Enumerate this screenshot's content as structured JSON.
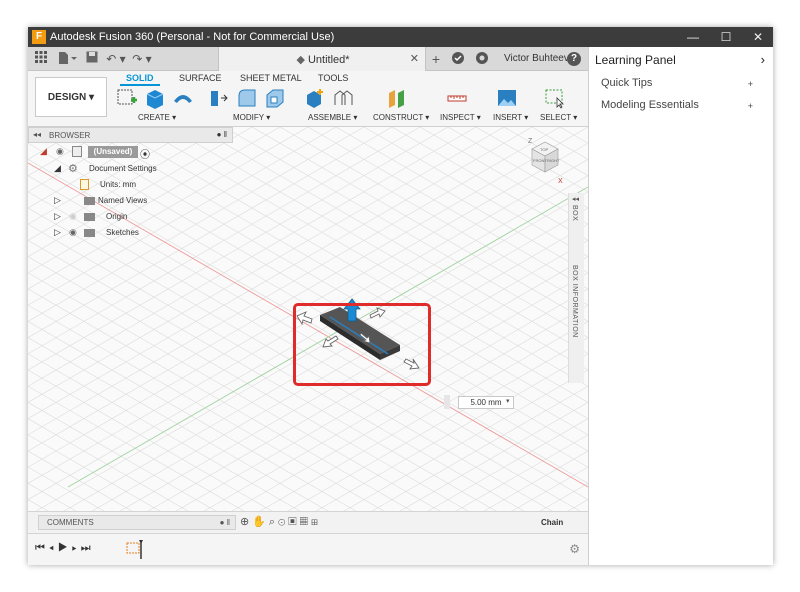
{
  "window": {
    "title": "Autodesk Fusion 360 (Personal - Not for Commercial Use)",
    "app_icon_letter": "F",
    "controls": {
      "minimize": "—",
      "maximize": "☐",
      "close": "✕"
    }
  },
  "topbar": {
    "document_tab": "Untitled*",
    "close_tab": "✕",
    "user": "Victor Buhteev",
    "help": "?"
  },
  "ribbon": {
    "design_button": "DESIGN ▾",
    "tabs": [
      "SOLID",
      "SURFACE",
      "SHEET METAL",
      "TOOLS"
    ],
    "active_tab": "SOLID",
    "groups": [
      "CREATE ▾",
      "MODIFY ▾",
      "ASSEMBLE ▾",
      "CONSTRUCT ▾",
      "INSPECT ▾",
      "INSERT ▾",
      "SELECT ▾"
    ]
  },
  "browser": {
    "title": "BROWSER",
    "root": "(Unsaved)",
    "items": [
      "Document Settings",
      "Units: mm",
      "Named Views",
      "Origin",
      "Sketches"
    ]
  },
  "side_panels": {
    "box": "BOX",
    "box_information": "BOX INFORMATION"
  },
  "viewcube": {
    "top": "TOP",
    "front": "FRONT",
    "right": "RIGHT",
    "z": "Z",
    "x": "X"
  },
  "dimension": {
    "value": "5.00 mm"
  },
  "bottom": {
    "comments": "COMMENTS",
    "chain": "Chain"
  },
  "learning_panel": {
    "title": "Learning Panel",
    "items": [
      {
        "label": "Quick Tips",
        "expand": "+"
      },
      {
        "label": "Modeling Essentials",
        "expand": "+"
      }
    ]
  },
  "colors": {
    "accent": "#0696d7",
    "highlight": "#e02b2b",
    "titlebar": "#3c3c3c",
    "x_axis": "#e77",
    "y_axis": "#8c8"
  }
}
